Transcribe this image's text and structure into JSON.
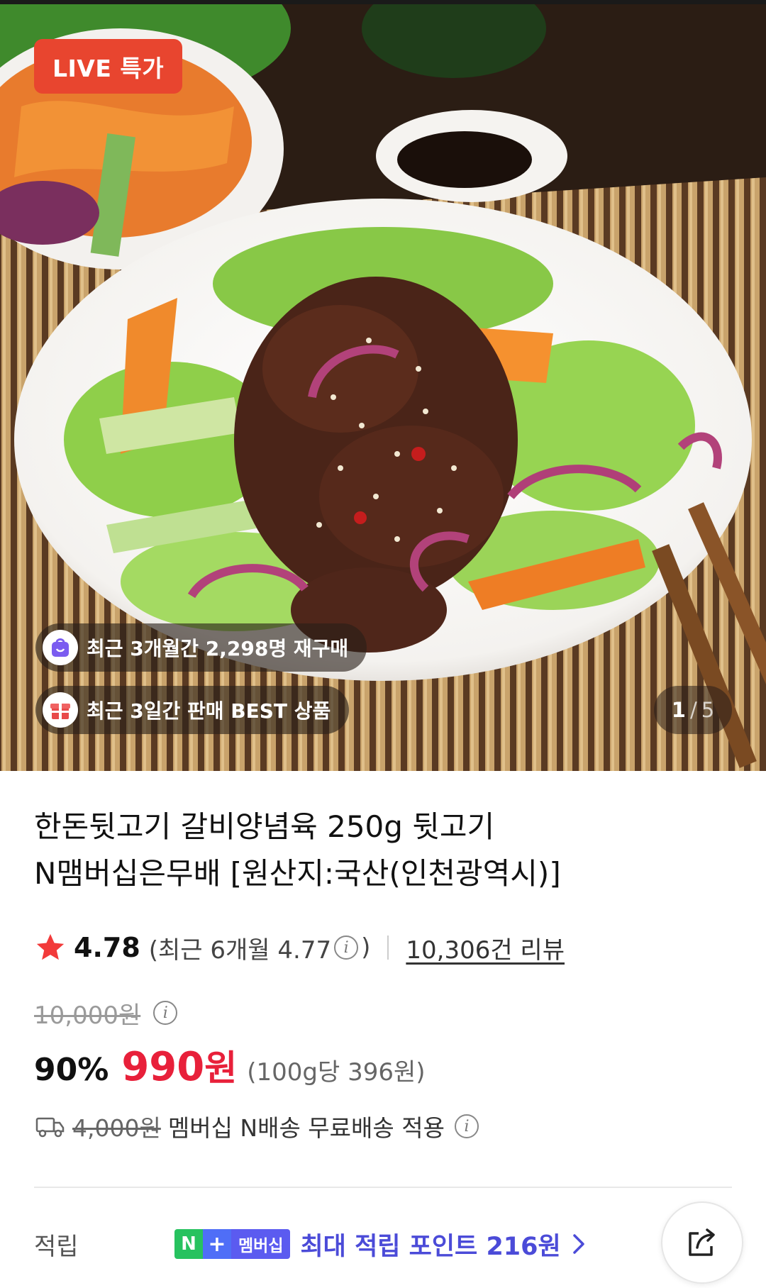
{
  "hero": {
    "live_badge": "LIVE 특가",
    "repurchase_text": "최근 3개월간 2,298명 재구매",
    "best_text": "최근 3일간 판매 BEST 상품",
    "counter_current": "1",
    "counter_separator": "/",
    "counter_total": "5"
  },
  "product": {
    "title_line1": "한돈뒷고기 갈비양념육 250g 뒷고기",
    "title_line2": "N맴버십은무배 [원산지:국산(인천광역시)]",
    "rating": "4.78",
    "recent_rating_text": "(최근 6개월 4.77",
    "recent_rating_close": ")",
    "review_count": "10,306건 리뷰",
    "original_price": "10,000원",
    "discount_rate": "90%",
    "sale_price": "990",
    "sale_price_unit": "원",
    "unit_price": "(100g당 396원)",
    "shipping_original": "4,000원",
    "shipping_text": "멤버십 N배송 무료배송 적용",
    "points_label": "적립",
    "points_badge_n": "N",
    "points_badge_plus": "+",
    "points_badge_text": "멤버십",
    "points_text": "최대 적립 포인트 216원"
  },
  "colors": {
    "accent_red": "#e8203a",
    "live_badge": "#e8452f",
    "points_blue": "#4b4bd8",
    "npay_green": "#27c25f"
  },
  "icons": [
    "star-icon",
    "info-icon",
    "truck-icon",
    "chevron-right-icon",
    "share-icon",
    "repurchase-bag-icon",
    "gift-box-icon"
  ]
}
